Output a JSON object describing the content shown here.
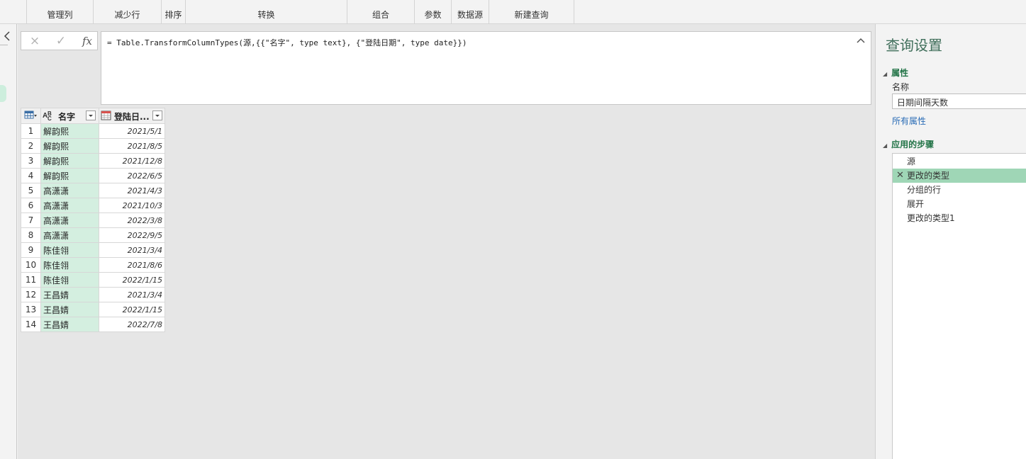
{
  "ribbon": {
    "groups": [
      "管理列",
      "减少行",
      "排序",
      "转换",
      "组合",
      "参数",
      "数据源",
      "新建查询"
    ]
  },
  "formula_bar": {
    "cancel_icon": "×",
    "confirm_icon": "✓",
    "fx_label": "fx",
    "formula": "= Table.TransformColumnTypes(源,{{\"名字\", type text}, {\"登陆日期\", type date}})"
  },
  "table": {
    "columns": [
      {
        "name": "名字",
        "type_icon": "text-type-icon"
      },
      {
        "name": "登陆日...",
        "type_icon": "date-type-icon"
      }
    ],
    "rows": [
      {
        "n": "1",
        "name": "解韵熙",
        "date": "2021/5/1"
      },
      {
        "n": "2",
        "name": "解韵熙",
        "date": "2021/8/5"
      },
      {
        "n": "3",
        "name": "解韵熙",
        "date": "2021/12/8"
      },
      {
        "n": "4",
        "name": "解韵熙",
        "date": "2022/6/5"
      },
      {
        "n": "5",
        "name": "高潇潇",
        "date": "2021/4/3"
      },
      {
        "n": "6",
        "name": "高潇潇",
        "date": "2021/10/3"
      },
      {
        "n": "7",
        "name": "高潇潇",
        "date": "2022/3/8"
      },
      {
        "n": "8",
        "name": "高潇潇",
        "date": "2022/9/5"
      },
      {
        "n": "9",
        "name": "陈佳翎",
        "date": "2021/3/4"
      },
      {
        "n": "10",
        "name": "陈佳翎",
        "date": "2021/8/6"
      },
      {
        "n": "11",
        "name": "陈佳翎",
        "date": "2022/1/15"
      },
      {
        "n": "12",
        "name": "王昌婧",
        "date": "2021/3/4"
      },
      {
        "n": "13",
        "name": "王昌婧",
        "date": "2022/1/15"
      },
      {
        "n": "14",
        "name": "王昌婧",
        "date": "2022/7/8"
      }
    ]
  },
  "query_settings": {
    "title": "查询设置",
    "properties_label": "属性",
    "name_label": "名称",
    "name_value": "日期间隔天数",
    "all_properties_link": "所有属性",
    "applied_steps_label": "应用的步骤",
    "steps": [
      {
        "label": "源",
        "selected": false
      },
      {
        "label": "更改的类型",
        "selected": true
      },
      {
        "label": "分组的行",
        "selected": false
      },
      {
        "label": "展开",
        "selected": false
      },
      {
        "label": "更改的类型1",
        "selected": false
      }
    ],
    "delete_step_icon": "✕"
  },
  "colors": {
    "accent_green": "#217346",
    "selected_step": "#9fd6b6",
    "text_column_fill": "#d4efe0",
    "link_blue": "#2a6cb6"
  }
}
